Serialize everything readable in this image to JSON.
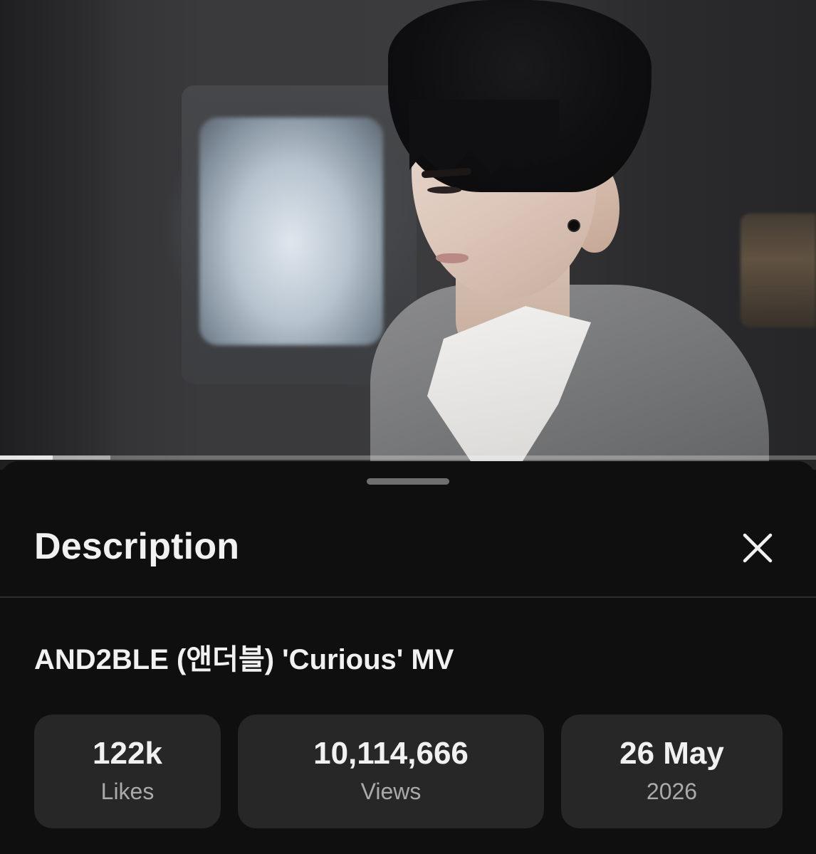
{
  "video": {
    "progress_fraction": 0.065,
    "buffer_fraction": 0.135
  },
  "sheet": {
    "title": "Description",
    "close_icon": "close-icon"
  },
  "details": {
    "video_title": "AND2BLE (앤더블) 'Curious' MV",
    "stats": [
      {
        "value": "122k",
        "label": "Likes"
      },
      {
        "value": "10,114,666",
        "label": "Views"
      },
      {
        "value": "26 May",
        "label": "2026"
      }
    ]
  },
  "colors": {
    "background": "#0f0f0f",
    "card": "#272727",
    "text_primary": "#f1f1f1",
    "text_secondary": "#aaaaaa"
  }
}
